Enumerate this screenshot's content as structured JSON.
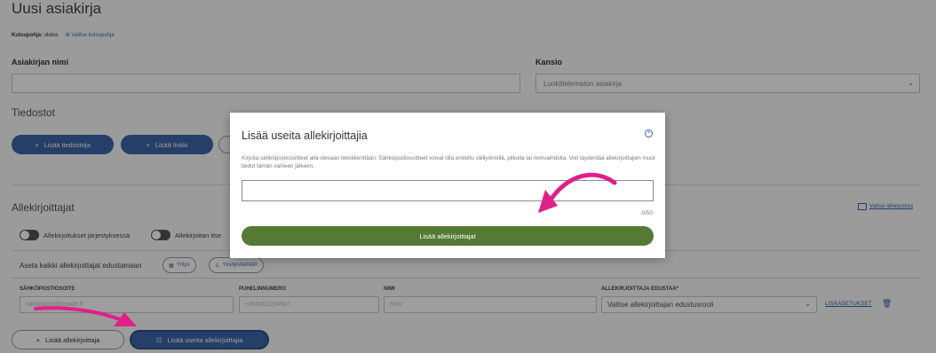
{
  "header": {
    "title": "Uusi asiakirja",
    "kutsupohja_label": "Kutsupohja:",
    "kutsupohja_value": "oletus",
    "select_template_link": "Valitse kutsupohja"
  },
  "form": {
    "name_label": "Asiakirjan nimi",
    "name_value": "",
    "folder_label": "Kansio",
    "folder_value": "Luokittelematon asiakirja"
  },
  "files": {
    "heading": "Tiedostot",
    "add_files_button": "Lisää tiedostoja",
    "add_link_button": "Lisää linkki"
  },
  "signers": {
    "heading": "Allekirjoittajat",
    "select_mailing_list_link": "Valitse lähetyslista",
    "toggle_order_label": "Allekirjoitukset järjestyksessä",
    "toggle_self_label": "Allekirjoitan itse",
    "represent_all_label": "Aseta kaikki allekirjoittajat edustamaan",
    "company_pill": "Yritys",
    "private_pill": "Yksityishenkilö",
    "columns": {
      "email": "SÄHKÖPOSTIOSOITE",
      "phone": "PUHELINNUMERO",
      "name": "NIMI",
      "represents": "ALLEKIRJOITTAJA EDUSTAA*"
    },
    "row": {
      "email_placeholder": "sähköposti@osoite.fi",
      "phone_placeholder": "+358401234567",
      "name_placeholder": "Nimi",
      "represents_value": "Valitse allekirjoittajan edustusrooli",
      "more_settings_link": "LISÄASETUKSET"
    },
    "add_signer_button": "Lisää allekirjoittaja",
    "add_multiple_button": "Lisää useita allekirjoittajia"
  },
  "modal": {
    "title": "Lisää useita allekirjoittajia",
    "description": "Kirjoita sähköpostiosoitteet alla olevaan tekstikenttään. Sähköpostiosoitteet voivat olla eroteltu välilyönnillä, pilkulla tai rivinvaihdolla. Voit täydentää allekirjoittajien muut tiedot tämän vaiheen jälkeen.",
    "textarea_value": "",
    "counter": "0/50",
    "submit_button": "Lisää allekirjoittajat"
  },
  "colors": {
    "blue": "#3c66a8",
    "green": "#557a33",
    "arrow": "#e0208a"
  }
}
